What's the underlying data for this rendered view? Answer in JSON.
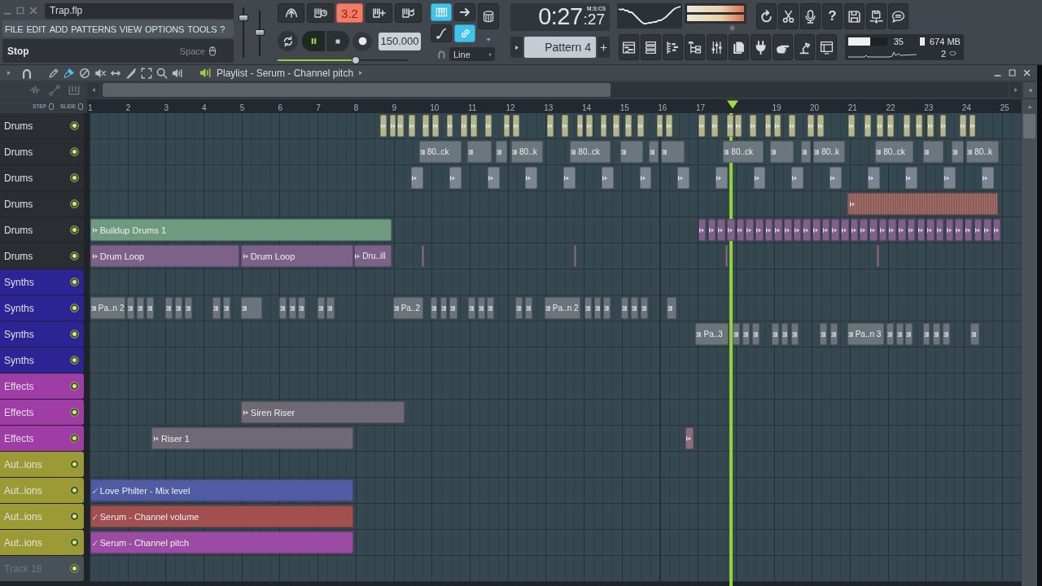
{
  "window": {
    "title": "Trap.flp"
  },
  "menu": [
    "FILE",
    "EDIT",
    "ADD",
    "PATTERNS",
    "VIEW",
    "OPTIONS",
    "TOOLS",
    "?"
  ],
  "hint_bar": {
    "text": "Stop",
    "shortcut": "Space"
  },
  "master": {
    "volume": {
      "level": 0.83
    },
    "pitch": {
      "level": 0.52
    }
  },
  "transport": {
    "counter": {
      "label": "3.2",
      "on": true
    },
    "playing": true,
    "tempo": "150.000",
    "song_position": {
      "level": 0.6
    }
  },
  "snap": {
    "keyboard_toggle": {
      "on": true
    },
    "link_toggle": {
      "on": true
    },
    "mode": "Line"
  },
  "time": {
    "value": "0:27",
    "centiseconds": ":27",
    "unit": "M:S:CS"
  },
  "pattern": {
    "name": "Pattern 4"
  },
  "meter": [
    {
      "level": 1
    },
    {
      "level": 1
    }
  ],
  "help_button": {
    "label": "?"
  },
  "cpu": {
    "reading": "35",
    "level": 0.57
  },
  "memory": {
    "reading": "674 MB"
  },
  "polyphony": {
    "reading": "2"
  },
  "playlist": {
    "title": "Playlist - Serum - Channel pitch",
    "tools": [
      {
        "selected": false
      },
      {
        "selected": true
      },
      {
        "selected": false
      },
      {
        "selected": false
      },
      {
        "selected": false
      },
      {
        "selected": false
      },
      {
        "selected": false
      },
      {
        "selected": false
      },
      {
        "selected": false
      }
    ],
    "step": {
      "label": "STEP",
      "checked": false
    },
    "slide": {
      "label": "SLIDE",
      "checked": false
    },
    "ruler": [
      {
        "kind": "bar",
        "label": "1"
      },
      {
        "kind": "bar",
        "label": "2"
      },
      {
        "kind": "bar",
        "label": "3"
      },
      {
        "kind": "bar",
        "label": "4"
      },
      {
        "kind": "bar",
        "label": "5"
      },
      {
        "kind": "bar",
        "label": "6"
      },
      {
        "kind": "bar",
        "label": "7"
      },
      {
        "kind": "bar",
        "label": "8"
      },
      {
        "kind": "bar",
        "label": "9"
      },
      {
        "kind": "bar",
        "label": "10"
      },
      {
        "kind": "bar",
        "label": "11"
      },
      {
        "kind": "bar",
        "label": "12"
      },
      {
        "kind": "bar",
        "label": "13"
      },
      {
        "kind": "bar",
        "label": "14"
      },
      {
        "kind": "bar",
        "label": "15"
      },
      {
        "kind": "bar",
        "label": "16"
      },
      {
        "kind": "bar",
        "label": "17"
      },
      {
        "kind": "playhead"
      },
      {
        "kind": "bar",
        "label": "19"
      },
      {
        "kind": "bar",
        "label": "20"
      },
      {
        "kind": "bar",
        "label": "21"
      },
      {
        "kind": "bar",
        "label": "22"
      },
      {
        "kind": "bar",
        "label": "23"
      },
      {
        "kind": "bar",
        "label": "24"
      },
      {
        "kind": "bar",
        "label": "25"
      }
    ],
    "tracks": [
      {
        "name": "Drums",
        "color": "#2b2d32",
        "enabled": true,
        "dimmed": false,
        "clips": [
          {
            "kind": "audio",
            "color": "#b5b58c"
          },
          {
            "kind": "audio",
            "color": "#b5b58c"
          },
          {
            "kind": "audio",
            "color": "#b5b58c"
          },
          {
            "kind": "audio",
            "color": "#b5b58c"
          },
          {
            "kind": "audio",
            "color": "#b5b58c"
          },
          {
            "kind": "audio",
            "color": "#b5b58c"
          },
          {
            "kind": "audio",
            "color": "#b5b58c"
          },
          {
            "kind": "audio",
            "color": "#b5b58c"
          },
          {
            "kind": "audio",
            "color": "#b5b58c"
          },
          {
            "kind": "audio",
            "color": "#b5b58c"
          },
          {
            "kind": "audio",
            "color": "#b5b58c"
          },
          {
            "kind": "audio",
            "color": "#b5b58c"
          },
          {
            "kind": "audio",
            "color": "#b5b58c"
          },
          {
            "kind": "audio",
            "color": "#b5b58c"
          },
          {
            "kind": "audio",
            "color": "#b5b58c"
          },
          {
            "kind": "audio",
            "color": "#b5b58c"
          },
          {
            "kind": "audio",
            "color": "#b5b58c"
          },
          {
            "kind": "audio",
            "color": "#b5b58c"
          },
          {
            "kind": "audio",
            "color": "#b5b58c"
          },
          {
            "kind": "audio",
            "color": "#b5b58c"
          },
          {
            "kind": "audio",
            "color": "#b5b58c"
          },
          {
            "kind": "audio",
            "color": "#b5b58c"
          },
          {
            "kind": "audio",
            "color": "#b5b58c"
          },
          {
            "kind": "audio",
            "color": "#b5b58c"
          },
          {
            "kind": "audio",
            "color": "#b5b58c"
          },
          {
            "kind": "audio",
            "color": "#b5b58c"
          },
          {
            "kind": "audio",
            "color": "#b5b58c"
          },
          {
            "kind": "audio",
            "color": "#b5b58c"
          },
          {
            "kind": "audio",
            "color": "#b5b58c"
          },
          {
            "kind": "audio",
            "color": "#b5b58c"
          },
          {
            "kind": "audio",
            "color": "#b5b58c"
          },
          {
            "kind": "audio",
            "color": "#b5b58c"
          },
          {
            "kind": "audio",
            "color": "#b5b58c"
          },
          {
            "kind": "audio",
            "color": "#b5b58c"
          },
          {
            "kind": "audio",
            "color": "#b5b58c"
          },
          {
            "kind": "audio",
            "color": "#b5b58c"
          },
          {
            "kind": "audio",
            "color": "#b5b58c"
          },
          {
            "kind": "audio",
            "color": "#b5b58c"
          },
          {
            "kind": "audio",
            "color": "#b5b58c"
          },
          {
            "kind": "audio",
            "color": "#b5b58c"
          },
          {
            "kind": "audio",
            "color": "#b5b58c"
          },
          {
            "kind": "audio",
            "color": "#b5b58c"
          }
        ]
      },
      {
        "name": "Drums",
        "color": "#2b2d32",
        "enabled": true,
        "dimmed": false,
        "clips": [
          {
            "kind": "pattern",
            "color": "#6c767d",
            "label": "80..ck"
          },
          {
            "kind": "pattern",
            "color": "#6c767d"
          },
          {
            "kind": "pattern",
            "color": "#6c767d"
          },
          {
            "kind": "pattern",
            "color": "#6c767d",
            "label": "80..k"
          },
          {
            "kind": "pattern",
            "color": "#6c767d",
            "label": "80..ck"
          },
          {
            "kind": "pattern",
            "color": "#6c767d"
          },
          {
            "kind": "pattern",
            "color": "#6c767d"
          },
          {
            "kind": "pattern",
            "color": "#6c767d"
          },
          {
            "kind": "pattern",
            "color": "#6c767d",
            "label": "80..ck"
          },
          {
            "kind": "pattern",
            "color": "#6c767d"
          },
          {
            "kind": "pattern",
            "color": "#6c767d"
          },
          {
            "kind": "pattern",
            "color": "#6c767d",
            "label": "80..k"
          },
          {
            "kind": "pattern",
            "color": "#6c767d",
            "label": "80..ck"
          },
          {
            "kind": "pattern",
            "color": "#6c767d"
          },
          {
            "kind": "pattern",
            "color": "#6c767d"
          },
          {
            "kind": "pattern",
            "color": "#6c767d",
            "label": "80..k"
          }
        ]
      },
      {
        "name": "Drums",
        "color": "#2b2d32",
        "enabled": true,
        "dimmed": false,
        "clips": [
          {
            "kind": "audio",
            "color": "#7b8591"
          },
          {
            "kind": "audio",
            "color": "#7b8591"
          },
          {
            "kind": "audio",
            "color": "#7b8591"
          },
          {
            "kind": "audio",
            "color": "#7b8591"
          },
          {
            "kind": "audio",
            "color": "#7b8591"
          },
          {
            "kind": "audio",
            "color": "#7b8591"
          },
          {
            "kind": "audio",
            "color": "#7b8591"
          },
          {
            "kind": "audio",
            "color": "#7b8591"
          },
          {
            "kind": "audio",
            "color": "#7b8591"
          },
          {
            "kind": "audio",
            "color": "#7b8591"
          },
          {
            "kind": "audio",
            "color": "#7b8591"
          },
          {
            "kind": "audio",
            "color": "#7b8591"
          },
          {
            "kind": "audio",
            "color": "#7b8591"
          },
          {
            "kind": "audio",
            "color": "#7b8591"
          },
          {
            "kind": "audio",
            "color": "#7b8591"
          },
          {
            "kind": "audio",
            "color": "#7b8591"
          }
        ]
      },
      {
        "name": "Drums",
        "color": "#2b2d32",
        "enabled": true,
        "dimmed": false,
        "clips": [
          {
            "kind": "audio",
            "color": "#8f5b57"
          }
        ]
      },
      {
        "name": "Drums",
        "color": "#2b2d32",
        "enabled": true,
        "dimmed": false,
        "clips": [
          {
            "kind": "audio",
            "color": "#6f9a80",
            "label": "Buildup Drums 1"
          },
          {
            "kind": "audio",
            "color": "#80608a"
          },
          {
            "kind": "audio",
            "color": "#80608a"
          },
          {
            "kind": "audio",
            "color": "#80608a"
          },
          {
            "kind": "audio",
            "color": "#80608a"
          },
          {
            "kind": "audio",
            "color": "#80608a"
          },
          {
            "kind": "audio",
            "color": "#80608a"
          },
          {
            "kind": "audio",
            "color": "#80608a"
          },
          {
            "kind": "audio",
            "color": "#80608a"
          },
          {
            "kind": "audio",
            "color": "#80608a"
          },
          {
            "kind": "audio",
            "color": "#80608a"
          },
          {
            "kind": "audio",
            "color": "#80608a"
          },
          {
            "kind": "audio",
            "color": "#80608a"
          },
          {
            "kind": "audio",
            "color": "#80608a"
          },
          {
            "kind": "audio",
            "color": "#80608a"
          },
          {
            "kind": "audio",
            "color": "#80608a"
          },
          {
            "kind": "audio",
            "color": "#80608a"
          },
          {
            "kind": "audio",
            "color": "#80608a"
          },
          {
            "kind": "audio",
            "color": "#80608a"
          },
          {
            "kind": "audio",
            "color": "#80608a"
          },
          {
            "kind": "audio",
            "color": "#80608a"
          },
          {
            "kind": "audio",
            "color": "#80608a"
          },
          {
            "kind": "audio",
            "color": "#80608a"
          },
          {
            "kind": "audio",
            "color": "#80608a"
          },
          {
            "kind": "audio",
            "color": "#80608a"
          },
          {
            "kind": "audio",
            "color": "#80608a"
          },
          {
            "kind": "audio",
            "color": "#80608a"
          },
          {
            "kind": "audio",
            "color": "#80608a"
          },
          {
            "kind": "audio",
            "color": "#80608a"
          },
          {
            "kind": "audio",
            "color": "#80608a"
          },
          {
            "kind": "audio",
            "color": "#80608a"
          },
          {
            "kind": "audio",
            "color": "#80608a"
          },
          {
            "kind": "audio",
            "color": "#80608a"
          }
        ]
      },
      {
        "name": "Drums",
        "color": "#2b2d32",
        "enabled": true,
        "dimmed": false,
        "clips": [
          {
            "kind": "audio",
            "color": "#7d6287",
            "label": "Drum Loop"
          },
          {
            "kind": "audio",
            "color": "#7d6287",
            "label": "Drum Loop"
          },
          {
            "kind": "audio",
            "color": "#7d6287",
            "label": "Dru..ill"
          },
          {
            "kind": "audio",
            "color": "#8a6a8e"
          },
          {
            "kind": "audio",
            "color": "#8a6a8e"
          },
          {
            "kind": "audio",
            "color": "#8a6a8e"
          },
          {
            "kind": "audio",
            "color": "#8a6a8e"
          }
        ]
      },
      {
        "name": "Synths",
        "color": "#2c2494",
        "enabled": true,
        "dimmed": false
      },
      {
        "name": "Synths",
        "color": "#2c2494",
        "enabled": true,
        "dimmed": false,
        "clips": [
          {
            "kind": "pattern",
            "color": "#6b747b",
            "label": "Pa..n 2"
          },
          {
            "kind": "pattern",
            "color": "#6b747b"
          },
          {
            "kind": "pattern",
            "color": "#6b747b"
          },
          {
            "kind": "pattern",
            "color": "#6b747b"
          },
          {
            "kind": "pattern",
            "color": "#6b747b"
          },
          {
            "kind": "pattern",
            "color": "#6b747b"
          },
          {
            "kind": "pattern",
            "color": "#6b747b"
          },
          {
            "kind": "pattern",
            "color": "#6b747b"
          },
          {
            "kind": "pattern",
            "color": "#6b747b"
          },
          {
            "kind": "pattern",
            "color": "#6b747b"
          },
          {
            "kind": "pattern",
            "color": "#6b747b"
          },
          {
            "kind": "pattern",
            "color": "#6b747b"
          },
          {
            "kind": "pattern",
            "color": "#6b747b"
          },
          {
            "kind": "pattern",
            "color": "#6b747b"
          },
          {
            "kind": "pattern",
            "color": "#6b747b"
          },
          {
            "kind": "pattern",
            "color": "#6b747b",
            "label": "Pa..2"
          },
          {
            "kind": "pattern",
            "color": "#6b747b"
          },
          {
            "kind": "pattern",
            "color": "#6b747b"
          },
          {
            "kind": "pattern",
            "color": "#6b747b"
          },
          {
            "kind": "pattern",
            "color": "#6b747b"
          },
          {
            "kind": "pattern",
            "color": "#6b747b"
          },
          {
            "kind": "pattern",
            "color": "#6b747b"
          },
          {
            "kind": "pattern",
            "color": "#6b747b"
          },
          {
            "kind": "pattern",
            "color": "#6b747b"
          },
          {
            "kind": "pattern",
            "color": "#6b747b",
            "label": "Pa..n 2"
          },
          {
            "kind": "pattern",
            "color": "#6b747b"
          },
          {
            "kind": "pattern",
            "color": "#6b747b"
          },
          {
            "kind": "pattern",
            "color": "#6b747b"
          },
          {
            "kind": "pattern",
            "color": "#6b747b"
          },
          {
            "kind": "pattern",
            "color": "#6b747b"
          },
          {
            "kind": "pattern",
            "color": "#6b747b"
          },
          {
            "kind": "pattern",
            "color": "#6b747b"
          }
        ]
      },
      {
        "name": "Synths",
        "color": "#2c2494",
        "enabled": true,
        "dimmed": false,
        "clips": [
          {
            "kind": "pattern",
            "color": "#6b747b",
            "label": "Pa..3"
          },
          {
            "kind": "pattern",
            "color": "#6b747b"
          },
          {
            "kind": "pattern",
            "color": "#6b747b"
          },
          {
            "kind": "pattern",
            "color": "#6b747b"
          },
          {
            "kind": "pattern",
            "color": "#6b747b"
          },
          {
            "kind": "pattern",
            "color": "#6b747b"
          },
          {
            "kind": "pattern",
            "color": "#6b747b"
          },
          {
            "kind": "pattern",
            "color": "#6b747b"
          },
          {
            "kind": "pattern",
            "color": "#6b747b"
          },
          {
            "kind": "pattern",
            "color": "#6b747b",
            "label": "Pa..n 3"
          },
          {
            "kind": "pattern",
            "color": "#6b747b"
          },
          {
            "kind": "pattern",
            "color": "#6b747b"
          },
          {
            "kind": "pattern",
            "color": "#6b747b"
          },
          {
            "kind": "pattern",
            "color": "#6b747b"
          },
          {
            "kind": "pattern",
            "color": "#6b747b"
          },
          {
            "kind": "pattern",
            "color": "#6b747b"
          },
          {
            "kind": "pattern",
            "color": "#6b747b"
          }
        ]
      },
      {
        "name": "Synths",
        "color": "#2c2494",
        "enabled": true,
        "dimmed": false
      },
      {
        "name": "Effects",
        "color": "#a03ca6",
        "enabled": true,
        "dimmed": false
      },
      {
        "name": "Effects",
        "color": "#a03ca6",
        "enabled": true,
        "dimmed": false,
        "clips": [
          {
            "kind": "audio",
            "color": "#6f6875",
            "label": "Siren Riser"
          }
        ]
      },
      {
        "name": "Effects",
        "color": "#a03ca6",
        "enabled": true,
        "dimmed": false,
        "clips": [
          {
            "kind": "audio",
            "color": "#6f6875",
            "label": "Riser 1"
          },
          {
            "kind": "audio",
            "color": "#8c6c7a"
          }
        ]
      },
      {
        "name": "Aut..ions",
        "color": "#9c9a34",
        "enabled": true,
        "dimmed": false
      },
      {
        "name": "Aut..ions",
        "color": "#9c9a34",
        "enabled": true,
        "dimmed": false,
        "clips": [
          {
            "kind": "automation",
            "color": "#4f5ca3",
            "label": "Love Philter - Mix level"
          }
        ]
      },
      {
        "name": "Aut..ions",
        "color": "#9c9a34",
        "enabled": true,
        "dimmed": false,
        "clips": [
          {
            "kind": "automation",
            "color": "#a24f4f",
            "label": "Serum - Channel volume"
          }
        ]
      },
      {
        "name": "Aut..ions",
        "color": "#9c9a34",
        "enabled": true,
        "dimmed": false,
        "clips": [
          {
            "kind": "automation",
            "color": "#9b4ba3",
            "label": "Serum - Channel pitch"
          }
        ]
      },
      {
        "name": "Track 18",
        "color": "#485058",
        "enabled": true,
        "dimmed": true
      }
    ]
  }
}
